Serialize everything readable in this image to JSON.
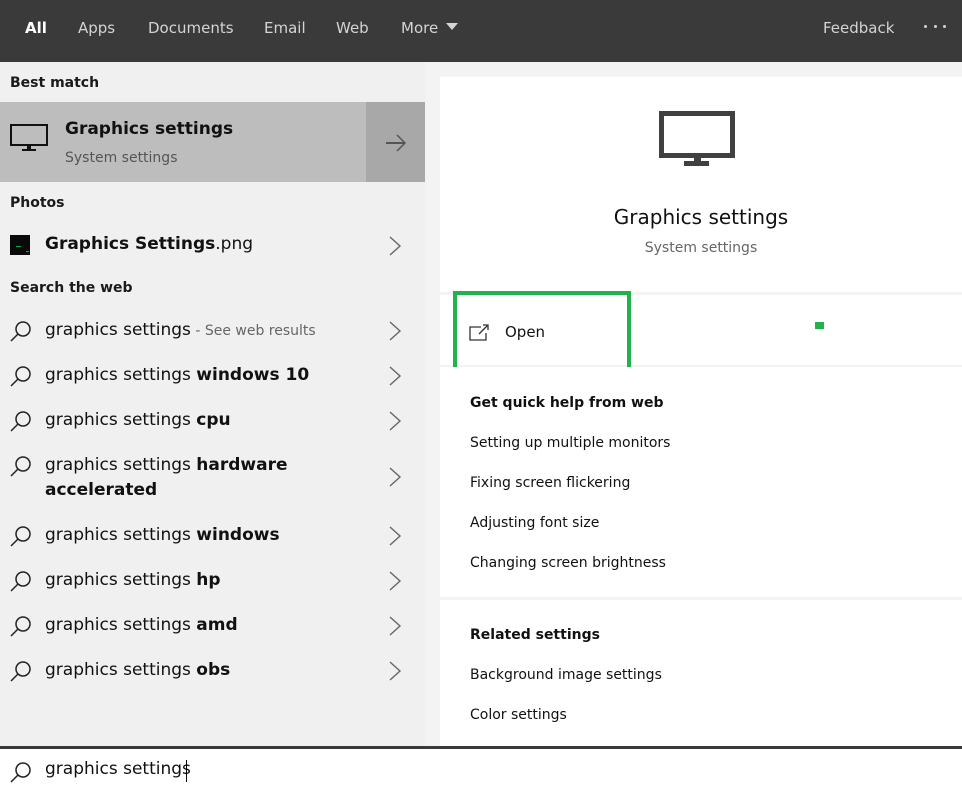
{
  "topbar": {
    "tabs": [
      {
        "label": "All",
        "active": true
      },
      {
        "label": "Apps"
      },
      {
        "label": "Documents"
      },
      {
        "label": "Email"
      },
      {
        "label": "Web"
      },
      {
        "label": "More"
      }
    ],
    "feedback_label": "Feedback",
    "more_options_icon": "ellipsis-icon"
  },
  "left": {
    "best_match": {
      "section_label": "Best match",
      "title": "Graphics settings",
      "subtitle": "System settings",
      "icon": "monitor-icon",
      "arrow_icon": "arrow-right-icon"
    },
    "photos": {
      "section_label": "Photos",
      "items": [
        {
          "name_bold": "Graphics Settings",
          "ext": ".png"
        }
      ]
    },
    "web": {
      "section_label": "Search the web",
      "items": [
        {
          "prefix": "graphics settings",
          "bold": "",
          "hint": " - See web results"
        },
        {
          "prefix": "graphics settings ",
          "bold": "windows 10"
        },
        {
          "prefix": "graphics settings ",
          "bold": "cpu"
        },
        {
          "prefix": "graphics settings ",
          "bold": "hardware",
          "bold2": "accelerated"
        },
        {
          "prefix": "graphics settings ",
          "bold": "windows"
        },
        {
          "prefix": "graphics settings ",
          "bold": "hp"
        },
        {
          "prefix": "graphics settings ",
          "bold": "amd"
        },
        {
          "prefix": "graphics settings ",
          "bold": "obs"
        }
      ]
    }
  },
  "right": {
    "title": "Graphics settings",
    "subtitle": "System settings",
    "open_label": "Open",
    "highlight_color": "#22b14c",
    "quick_help": {
      "heading": "Get quick help from web",
      "links": [
        "Setting up multiple monitors",
        "Fixing screen flickering",
        "Adjusting font size",
        "Changing screen brightness"
      ]
    },
    "related": {
      "heading": "Related settings",
      "links": [
        "Background image settings",
        "Color settings"
      ]
    }
  },
  "search": {
    "value": "graphics settings",
    "icon": "search-icon"
  }
}
